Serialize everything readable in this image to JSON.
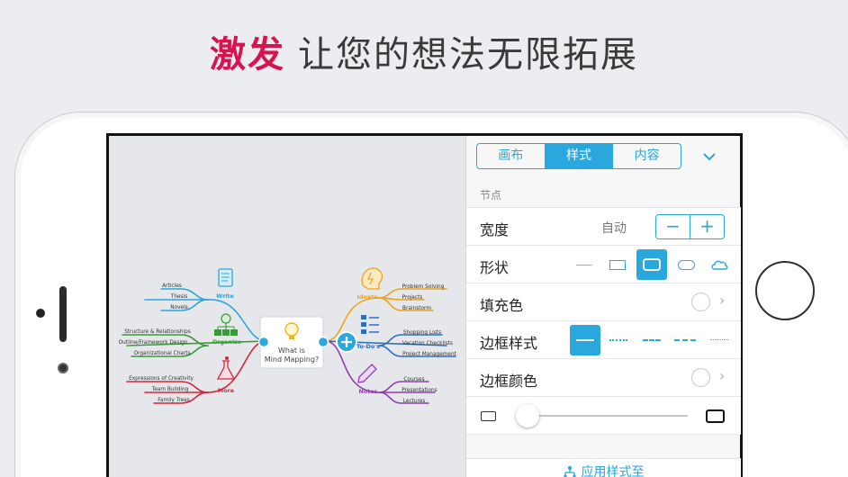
{
  "headline": {
    "accent": "激发",
    "text": "让您的想法无限拓展"
  },
  "tabs": [
    {
      "label": "画布"
    },
    {
      "label": "样式",
      "active": true
    },
    {
      "label": "内容"
    }
  ],
  "collapse_icon": "chevron-down-icon",
  "panel": {
    "section_title": "节点",
    "width_label": "宽度",
    "width_value": "自动",
    "stepper_minus": "−",
    "stepper_plus": "+",
    "shape_label": "形状",
    "shapes": [
      "none",
      "rectangle",
      "rounded-rectangle",
      "pill",
      "cloud"
    ],
    "selected_shape": "rounded-rectangle",
    "fill_label": "填充色",
    "border_style_label": "边框样式",
    "border_styles": [
      "solid",
      "dotted",
      "dashed",
      "dash-dot",
      "fine-dotted"
    ],
    "selected_border_style": "solid",
    "border_color_label": "边框颜色",
    "slider_value": 0.0,
    "apply_label": "应用样式至"
  },
  "mindmap": {
    "center": "What is\nMind Mapping?",
    "center_line1": "What is",
    "center_line2": "Mind Mapping?",
    "branches": {
      "write": {
        "label": "Write",
        "color": "#2aa7dc",
        "items": [
          "Articles",
          "Thesis",
          "Novels"
        ]
      },
      "organize": {
        "label": "Organize",
        "color": "#3a9a3a",
        "items": [
          "Structure & Relationships",
          "Outline/Framework Design",
          "Organizational Charts"
        ]
      },
      "more": {
        "label": "More",
        "color": "#d8253b",
        "items": [
          "Expressions of Creativity",
          "Team Building",
          "Family Trees"
        ]
      },
      "ideate": {
        "label": "Ideate",
        "color": "#f0a21c",
        "items": [
          "Problem Solving",
          "Projects",
          "Brainstorm"
        ]
      },
      "todos": {
        "label": "To-Do's",
        "color": "#2a6fc2",
        "items": [
          "Shopping Lists",
          "Vacation Checklists",
          "Project Management"
        ]
      },
      "notes": {
        "label": "Notes",
        "color": "#8e3fb0",
        "items": [
          "Courses",
          "Presentations",
          "Lectures"
        ]
      }
    }
  },
  "colors": {
    "accent": "#2aa7dc",
    "headline_accent": "#d8134f"
  }
}
